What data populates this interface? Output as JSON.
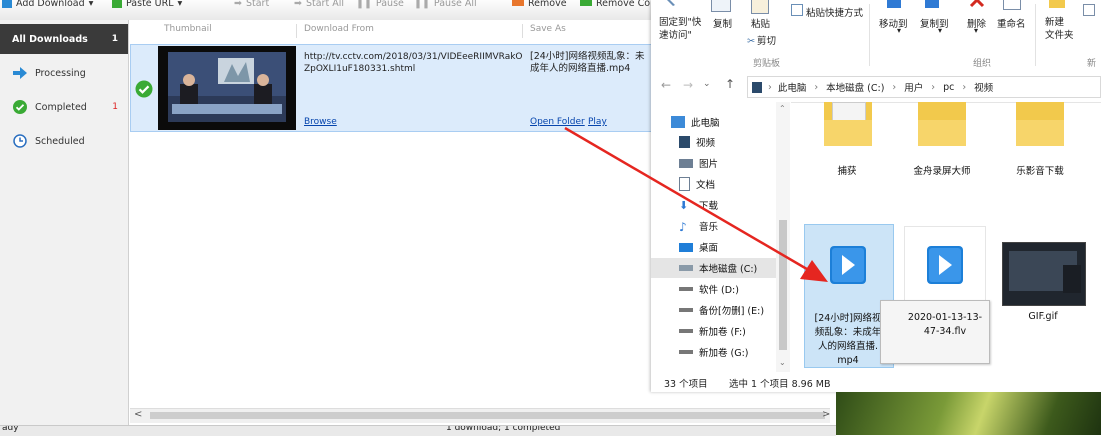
{
  "toolbar": {
    "add_download": "Add Download",
    "paste_url": "Paste URL",
    "start": "Start",
    "start_all": "Start All",
    "pause": "Pause",
    "pause_all": "Pause All",
    "remove": "Remove",
    "remove_completed": "Remove Co"
  },
  "sidebar": {
    "items": [
      {
        "label": "All Downloads",
        "count": "1",
        "icon": "all-icon"
      },
      {
        "label": "Processing",
        "count": "",
        "icon": "arrow-right-icon"
      },
      {
        "label": "Completed",
        "count": "1",
        "icon": "check-icon"
      },
      {
        "label": "Scheduled",
        "count": "",
        "icon": "clock-icon"
      }
    ]
  },
  "columns": {
    "thumbnail": "Thumbnail",
    "download_from": "Download From",
    "save_as": "Save As"
  },
  "download": {
    "url_line1": "http://tv.cctv.com/2018/03/31/VIDEeeRIIMVRakO",
    "url_line2": "ZpOXLI1uF180331.shtml",
    "save_line1": "[24小时]网络视频乱象：未",
    "save_line2": "成年人的网络直播.mp4",
    "browse": "Browse",
    "open_folder": "Open Folder",
    "play": "Play"
  },
  "statusbar": {
    "left": "ady",
    "center": "1 download; 1 completed"
  },
  "ribbon": {
    "pin": "固定到\"快",
    "pin2": "速访问\"",
    "copy": "复制",
    "paste": "粘贴",
    "paste_shortcut": "粘贴快捷方式",
    "cut": "剪切",
    "move_to": "移动到",
    "copy_to": "复制到",
    "delete": "删除",
    "rename": "重命名",
    "new_folder": "新建",
    "new_folder2": "文件夹",
    "group_clipboard": "剪贴板",
    "group_organize": "组织",
    "group_new": "新"
  },
  "address": {
    "crumbs": [
      "此电脑",
      "本地磁盘 (C:)",
      "用户",
      "pc",
      "视频"
    ]
  },
  "nav_pane": {
    "items": [
      "此电脑",
      "视频",
      "图片",
      "文档",
      "下载",
      "音乐",
      "桌面",
      "本地磁盘 (C:)",
      "软件 (D:)",
      "备份[勿删] (E:)",
      "新加卷 (F:)",
      "新加卷 (G:)"
    ]
  },
  "files": {
    "folders": [
      "捕获",
      "金舟录屏大师",
      "乐影音下载"
    ],
    "items": [
      {
        "name": "[24小时]网络视频乱象：未成年人的网络直播.mp4",
        "selected": true
      },
      {
        "name": "2020-01-13-13-47-34.flv",
        "selected": false
      },
      {
        "name": "GIF.gif",
        "selected": false
      }
    ],
    "name1_l1": "[24小时]网络视",
    "name1_l2": "频乱象：未成年",
    "name1_l3": "人的网络直播.",
    "name1_l4": "mp4",
    "name2_l1": "2020-01-13-13-",
    "name2_l2": "47-34.flv",
    "name3": "GIF.gif"
  },
  "explorer_status": {
    "count": "33 个项目",
    "selected": "选中 1 个项目  8.96 MB"
  },
  "colors": {
    "accent_arrow": "#e52620",
    "selection": "#cce4f7",
    "play_blue": "#1c7fd8"
  }
}
